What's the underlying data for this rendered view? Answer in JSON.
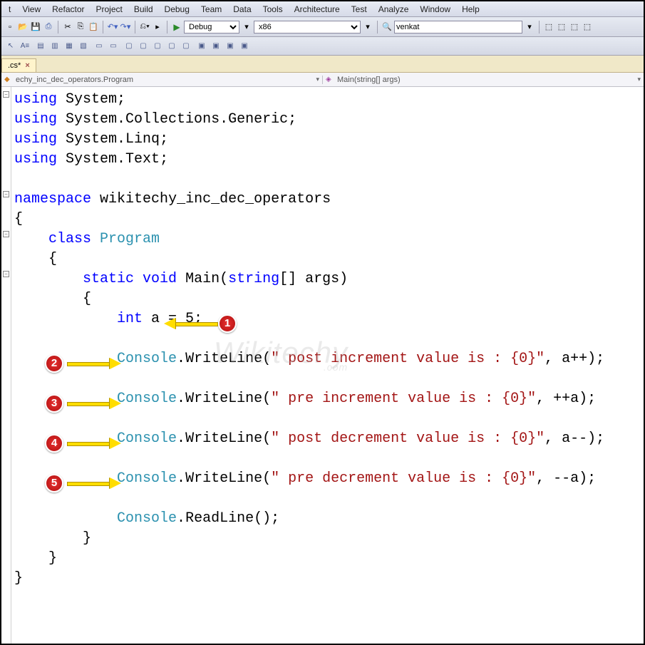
{
  "menu": [
    "t",
    "View",
    "Refactor",
    "Project",
    "Build",
    "Debug",
    "Team",
    "Data",
    "Tools",
    "Architecture",
    "Test",
    "Analyze",
    "Window",
    "Help"
  ],
  "toolbar": {
    "config": "Debug",
    "platform": "x86",
    "user": "venkat"
  },
  "tab": {
    "name": ".cs*"
  },
  "nav": {
    "left": "echy_inc_dec_operators.Program",
    "right": "Main(string[] args)"
  },
  "code": {
    "usings": [
      "System",
      "System.Collections.Generic",
      "System.Linq",
      "System.Text"
    ],
    "namespace": "wikitechy_inc_dec_operators",
    "class": "Program",
    "method_sig": {
      "mod": "static void",
      "name": "Main",
      "params_kw": "string",
      "params_rest": "[] args"
    },
    "decl": {
      "type": "int",
      "rest": " a = 5;"
    },
    "lines": [
      {
        "obj": "Console",
        "method": "WriteLine",
        "str": "\" post increment value is : {0}\"",
        "tail": ", a++);"
      },
      {
        "obj": "Console",
        "method": "WriteLine",
        "str": "\" pre increment value is : {0}\"",
        "tail": ", ++a);"
      },
      {
        "obj": "Console",
        "method": "WriteLine",
        "str": "\" post decrement value is : {0}\"",
        "tail": ", a--);"
      },
      {
        "obj": "Console",
        "method": "WriteLine",
        "str": "\" pre decrement value is : {0}\"",
        "tail": ", --a);"
      }
    ],
    "readline": {
      "obj": "Console",
      "method": "ReadLine",
      "tail": "();"
    }
  },
  "badges": [
    "1",
    "2",
    "3",
    "4",
    "5"
  ],
  "watermark": {
    "big": "Wikitechy",
    "small": ".com"
  }
}
